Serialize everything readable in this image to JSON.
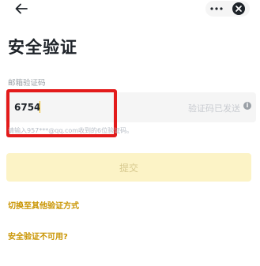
{
  "page": {
    "title": "安全验证"
  },
  "email_code": {
    "label": "邮箱验证码",
    "value": "6754",
    "status": "验证码已发送",
    "hint": "请输入957***@qq.com收到的6位验证码。"
  },
  "actions": {
    "submit_label": "提交",
    "switch_method": "切换至其他验证方式",
    "unavailable": "安全验证不可用?"
  },
  "colors": {
    "accent": "#c99400",
    "submit_disabled_bg": "#fcf3c6",
    "highlight_border": "#e31b1b"
  }
}
